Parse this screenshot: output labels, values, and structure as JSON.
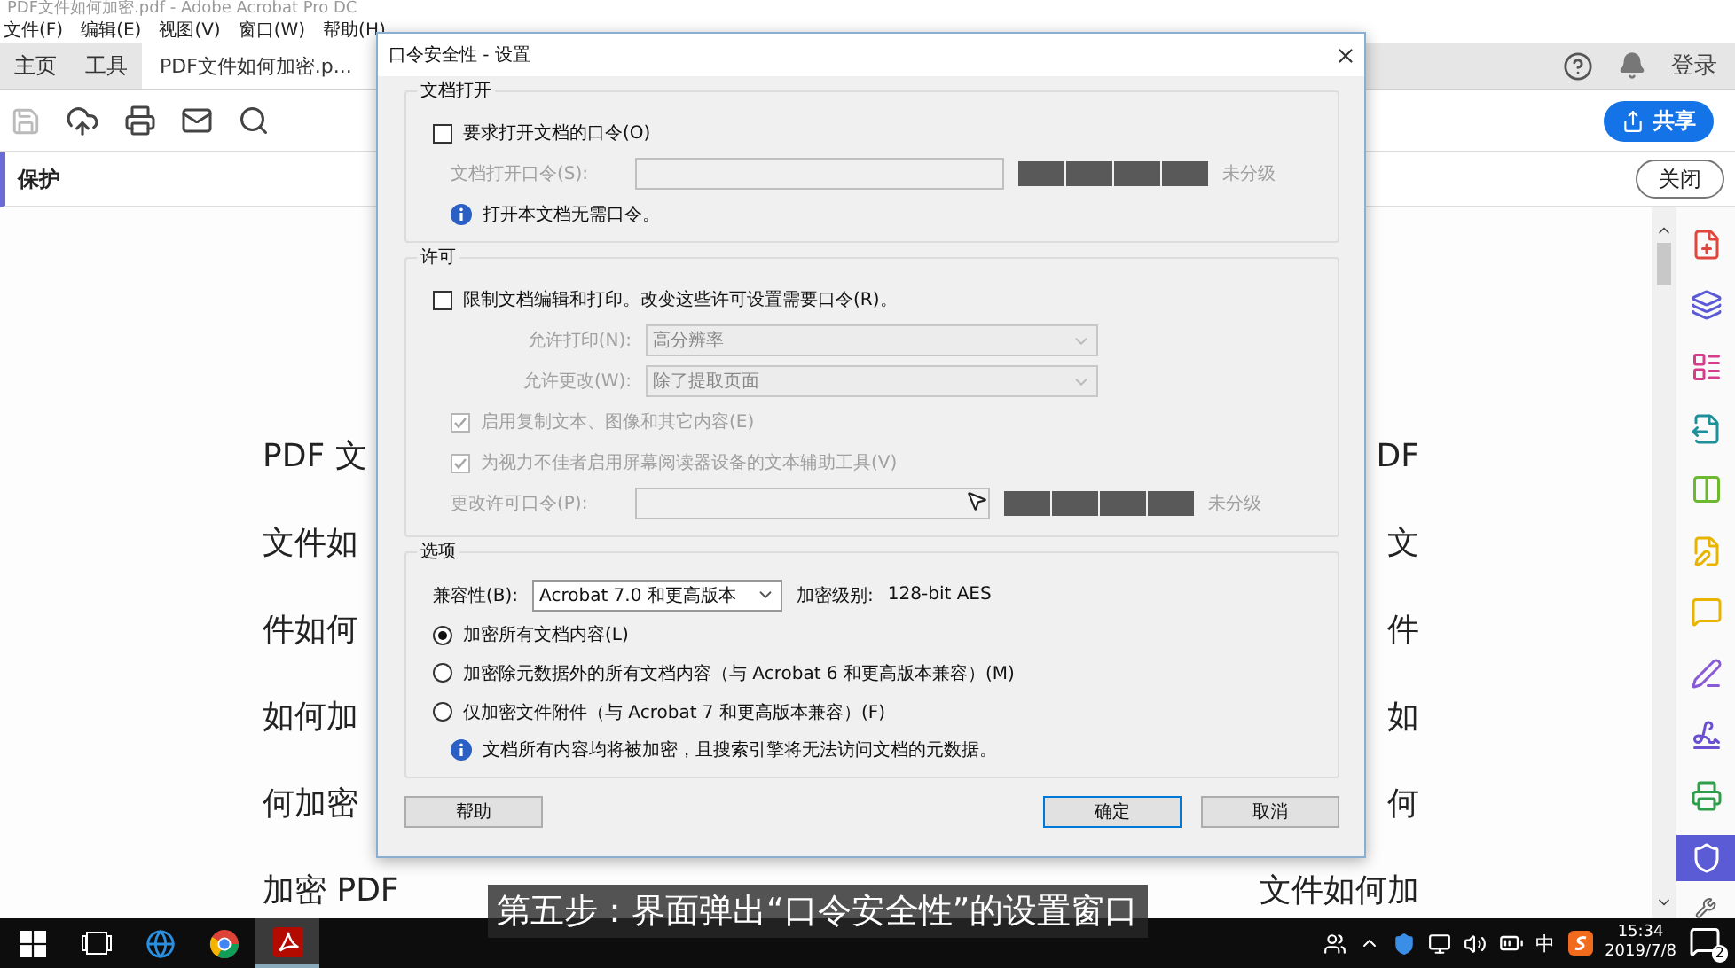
{
  "app": {
    "title": "PDF文件如何加密.pdf - Adobe Acrobat Pro DC"
  },
  "menu": [
    "文件(F)",
    "编辑(E)",
    "视图(V)",
    "窗口(W)",
    "帮助(H)"
  ],
  "tabs": [
    {
      "label": "主页",
      "selected": false
    },
    {
      "label": "工具",
      "selected": false
    },
    {
      "label": "PDF文件如何加密.p...",
      "selected": true
    }
  ],
  "header": {
    "sign_in": "登录",
    "share": "共享"
  },
  "panel": {
    "title": "保护",
    "close": "关闭"
  },
  "document": {
    "rows": [
      {
        "left": "PDF 文",
        "right": "DF"
      },
      {
        "left": "文件如",
        "right": "文"
      },
      {
        "left": "件如何",
        "right": "件"
      },
      {
        "left": "如何加",
        "right": "如"
      },
      {
        "left": "何加密",
        "right": "何"
      },
      {
        "left": "加密 PDF",
        "right": "文件如何加"
      }
    ]
  },
  "sidebar": {
    "tools": [
      {
        "kind": "create",
        "color": "#e0463c",
        "selected": false
      },
      {
        "kind": "combine",
        "color": "#5a5ad6",
        "selected": false
      },
      {
        "kind": "organize",
        "color": "#d63c8c",
        "selected": false
      },
      {
        "kind": "export",
        "color": "#1f8f9a",
        "selected": false
      },
      {
        "kind": "compare",
        "color": "#6cb82e",
        "selected": false
      },
      {
        "kind": "edit",
        "color": "#e8b400",
        "selected": false
      },
      {
        "kind": "comment",
        "color": "#e8b400",
        "selected": false
      },
      {
        "kind": "fill-sign",
        "color": "#8a5ad6",
        "selected": false
      },
      {
        "kind": "signature",
        "color": "#6a4fd0",
        "selected": false
      },
      {
        "kind": "print",
        "color": "#2e9e4a",
        "selected": false
      },
      {
        "kind": "protect",
        "color": "#5b5bd6",
        "selected": true
      }
    ]
  },
  "dialog": {
    "title": "口令安全性 - 设置",
    "open": {
      "heading": "文档打开",
      "require": {
        "label": "要求打开文档的口令(O)",
        "checked": false
      },
      "password": {
        "label": "文档打开口令(S):",
        "disabled": true
      },
      "rating": "未分级",
      "note": "打开本文档无需口令。"
    },
    "permissions": {
      "heading": "许可",
      "restrict": {
        "label": "限制文档编辑和打印。改变这些许可设置需要口令(R)。",
        "checked": false
      },
      "selects": [
        {
          "label": "允许打印(N):",
          "value": "高分辨率",
          "disabled": true
        },
        {
          "label": "允许更改(W):",
          "value": "除了提取页面",
          "disabled": true
        }
      ],
      "options": [
        {
          "label": "启用复制文本、图像和其它内容(E)",
          "checked": true,
          "disabled": true
        },
        {
          "label": "为视力不佳者启用屏幕阅读器设备的文本辅助工具(V)",
          "checked": true,
          "disabled": true
        }
      ],
      "password": {
        "label": "更改许可口令(P):",
        "disabled": true
      },
      "rating": "未分级"
    },
    "options": {
      "heading": "选项",
      "compat_label": "兼容性(B):",
      "compat_value": "Acrobat 7.0 和更高版本",
      "level_label": "加密级别:",
      "level_value": "128-bit AES",
      "radios": [
        {
          "label": "加密所有文档内容(L)",
          "selected": true
        },
        {
          "label": "加密除元数据外的所有文档内容（与 Acrobat 6 和更高版本兼容）(M)",
          "selected": false
        },
        {
          "label": "仅加密文件附件（与 Acrobat 7 和更高版本兼容）(F)",
          "selected": false
        }
      ],
      "note": "文档所有内容均将被加密，且搜索引擎将无法访问文档的元数据。"
    },
    "buttons": [
      {
        "label": "帮助",
        "default": false
      },
      {
        "label": "确定",
        "default": true
      },
      {
        "label": "取消",
        "default": false
      }
    ]
  },
  "subtitle": "第五步：界面弹出“口令安全性”的设置窗口",
  "taskbar": {
    "apps": [
      {
        "kind": "edge",
        "active": false
      },
      {
        "kind": "chrome",
        "active": false
      },
      {
        "kind": "acrobat",
        "active": true
      }
    ],
    "ime": "中",
    "time": "15:34",
    "date": "2019/7/8",
    "notifications": "2"
  }
}
